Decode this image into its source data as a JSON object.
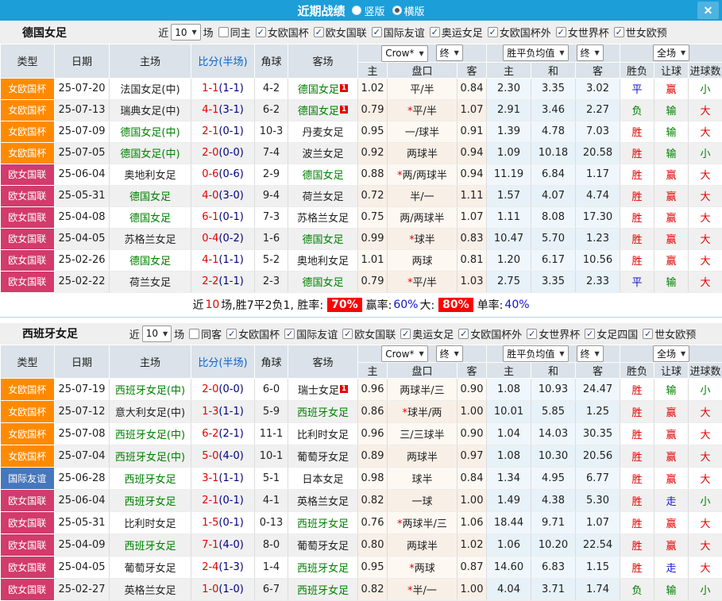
{
  "titlebar": {
    "title": "近期战绩",
    "vertical_label": "竖版",
    "horizontal_label": "横版",
    "close": "✕"
  },
  "columns": {
    "type": "类型",
    "date": "日期",
    "home": "主场",
    "score": "比分(半场)",
    "corner": "角球",
    "away": "客场",
    "odds_home": "主",
    "handicap": "盘口",
    "odds_away": "客",
    "avg_home": "主",
    "avg_draw": "和",
    "avg_away": "客",
    "result": "胜负",
    "handicap_col": "让球",
    "goals_col": "进球数"
  },
  "dropdowns": {
    "provider": "Crow*",
    "final": "终",
    "avg_label": "胜平负均值",
    "final2": "终",
    "scope": "全场"
  },
  "comp_colors": {
    "女欧国杯": "#ff8a00",
    "欧女国联": "#d23b6c",
    "国际友谊": "#4677bd"
  },
  "sections": [
    {
      "team": "德国女足",
      "filter": {
        "near_label": "近",
        "count": "10",
        "unit_label": "场",
        "same_label": "同主",
        "same_checked": false,
        "competitions": [
          "女欧国杯",
          "欧女国联",
          "国际友谊",
          "奥运女足",
          "女欧国杯外",
          "女世界杯",
          "世女欧预"
        ]
      },
      "rows": [
        {
          "comp": "女欧国杯",
          "date": "25-07-20",
          "home": "法国女足(中)",
          "home_active": false,
          "score": "1-1",
          "half": "(1-1)",
          "corner": "4-2",
          "away": "德国女足",
          "away_active": true,
          "away_badge": "1",
          "odds_home": "1.02",
          "handicap": "平/半",
          "handicap_star": false,
          "odds_away": "0.84",
          "avg_home": "2.30",
          "avg_draw": "3.35",
          "avg_away": "3.02",
          "result": "平",
          "result_c": "b",
          "ah": "赢",
          "ah_c": "r",
          "goals": "小",
          "goals_c": "g"
        },
        {
          "comp": "女欧国杯",
          "date": "25-07-13",
          "home": "瑞典女足(中)",
          "home_active": false,
          "score": "4-1",
          "half": "(3-1)",
          "corner": "6-2",
          "away": "德国女足",
          "away_active": true,
          "away_badge": "1",
          "odds_home": "0.79",
          "handicap": "平/半",
          "handicap_star": true,
          "odds_away": "1.07",
          "avg_home": "2.91",
          "avg_draw": "3.46",
          "avg_away": "2.27",
          "result": "负",
          "result_c": "g",
          "ah": "输",
          "ah_c": "g",
          "goals": "大",
          "goals_c": "r"
        },
        {
          "comp": "女欧国杯",
          "date": "25-07-09",
          "home": "德国女足(中)",
          "home_active": true,
          "score": "2-1",
          "half": "(0-1)",
          "corner": "10-3",
          "away": "丹麦女足",
          "away_active": false,
          "away_badge": "",
          "odds_home": "0.95",
          "handicap": "一/球半",
          "handicap_star": false,
          "odds_away": "0.91",
          "avg_home": "1.39",
          "avg_draw": "4.78",
          "avg_away": "7.03",
          "result": "胜",
          "result_c": "r",
          "ah": "输",
          "ah_c": "g",
          "goals": "大",
          "goals_c": "r"
        },
        {
          "comp": "女欧国杯",
          "date": "25-07-05",
          "home": "德国女足(中)",
          "home_active": true,
          "score": "2-0",
          "half": "(0-0)",
          "corner": "7-4",
          "away": "波兰女足",
          "away_active": false,
          "away_badge": "",
          "odds_home": "0.92",
          "handicap": "两球半",
          "handicap_star": false,
          "odds_away": "0.94",
          "avg_home": "1.09",
          "avg_draw": "10.18",
          "avg_away": "20.58",
          "result": "胜",
          "result_c": "r",
          "ah": "输",
          "ah_c": "g",
          "goals": "小",
          "goals_c": "g"
        },
        {
          "comp": "欧女国联",
          "date": "25-06-04",
          "home": "奥地利女足",
          "home_active": false,
          "score": "0-6",
          "half": "(0-6)",
          "corner": "2-9",
          "away": "德国女足",
          "away_active": true,
          "away_badge": "",
          "odds_home": "0.88",
          "handicap": "两/两球半",
          "handicap_star": true,
          "odds_away": "0.94",
          "avg_home": "11.19",
          "avg_draw": "6.84",
          "avg_away": "1.17",
          "result": "胜",
          "result_c": "r",
          "ah": "赢",
          "ah_c": "r",
          "goals": "大",
          "goals_c": "r"
        },
        {
          "comp": "欧女国联",
          "date": "25-05-31",
          "home": "德国女足",
          "home_active": true,
          "score": "4-0",
          "half": "(3-0)",
          "corner": "9-4",
          "away": "荷兰女足",
          "away_active": false,
          "away_badge": "",
          "odds_home": "0.72",
          "handicap": "半/一",
          "handicap_star": false,
          "odds_away": "1.11",
          "avg_home": "1.57",
          "avg_draw": "4.07",
          "avg_away": "4.74",
          "result": "胜",
          "result_c": "r",
          "ah": "赢",
          "ah_c": "r",
          "goals": "大",
          "goals_c": "r"
        },
        {
          "comp": "欧女国联",
          "date": "25-04-08",
          "home": "德国女足",
          "home_active": true,
          "score": "6-1",
          "half": "(0-1)",
          "corner": "7-3",
          "away": "苏格兰女足",
          "away_active": false,
          "away_badge": "",
          "odds_home": "0.75",
          "handicap": "两/两球半",
          "handicap_star": false,
          "odds_away": "1.07",
          "avg_home": "1.11",
          "avg_draw": "8.08",
          "avg_away": "17.30",
          "result": "胜",
          "result_c": "r",
          "ah": "赢",
          "ah_c": "r",
          "goals": "大",
          "goals_c": "r"
        },
        {
          "comp": "欧女国联",
          "date": "25-04-05",
          "home": "苏格兰女足",
          "home_active": false,
          "score": "0-4",
          "half": "(0-2)",
          "corner": "1-6",
          "away": "德国女足",
          "away_active": true,
          "away_badge": "",
          "odds_home": "0.99",
          "handicap": "球半",
          "handicap_star": true,
          "odds_away": "0.83",
          "avg_home": "10.47",
          "avg_draw": "5.70",
          "avg_away": "1.23",
          "result": "胜",
          "result_c": "r",
          "ah": "赢",
          "ah_c": "r",
          "goals": "大",
          "goals_c": "r"
        },
        {
          "comp": "欧女国联",
          "date": "25-02-26",
          "home": "德国女足",
          "home_active": true,
          "score": "4-1",
          "half": "(1-1)",
          "corner": "5-2",
          "away": "奥地利女足",
          "away_active": false,
          "away_badge": "",
          "odds_home": "1.01",
          "handicap": "两球",
          "handicap_star": false,
          "odds_away": "0.81",
          "avg_home": "1.20",
          "avg_draw": "6.17",
          "avg_away": "10.56",
          "result": "胜",
          "result_c": "r",
          "ah": "赢",
          "ah_c": "r",
          "goals": "大",
          "goals_c": "r"
        },
        {
          "comp": "欧女国联",
          "date": "25-02-22",
          "home": "荷兰女足",
          "home_active": false,
          "score": "2-2",
          "half": "(1-1)",
          "corner": "2-3",
          "away": "德国女足",
          "away_active": true,
          "away_badge": "",
          "odds_home": "0.79",
          "handicap": "平/半",
          "handicap_star": true,
          "odds_away": "1.03",
          "avg_home": "2.75",
          "avg_draw": "3.35",
          "avg_away": "2.33",
          "result": "平",
          "result_c": "b",
          "ah": "输",
          "ah_c": "g",
          "goals": "大",
          "goals_c": "r"
        }
      ],
      "summary": {
        "pre": "近",
        "count": "10",
        "text1": "场,胜7平2负1, 胜率:",
        "win_rate": "70%",
        "text2": "赢率:",
        "profit_rate": "60%",
        "text3": "大:",
        "big_rate": "80%",
        "text4": "单率:",
        "single_rate": "40%"
      }
    },
    {
      "team": "西班牙女足",
      "filter": {
        "near_label": "近",
        "count": "10",
        "unit_label": "场",
        "same_label": "同客",
        "same_checked": false,
        "competitions": [
          "女欧国杯",
          "国际友谊",
          "欧女国联",
          "奥运女足",
          "女欧国杯外",
          "女世界杯",
          "女足四国",
          "世女欧预"
        ]
      },
      "rows": [
        {
          "comp": "女欧国杯",
          "date": "25-07-19",
          "home": "西班牙女足(中)",
          "home_active": true,
          "score": "2-0",
          "half": "(0-0)",
          "corner": "6-0",
          "away": "瑞士女足",
          "away_active": false,
          "away_badge": "1",
          "odds_home": "0.96",
          "handicap": "两球半/三",
          "handicap_star": false,
          "odds_away": "0.90",
          "avg_home": "1.08",
          "avg_draw": "10.93",
          "avg_away": "24.47",
          "result": "胜",
          "result_c": "r",
          "ah": "输",
          "ah_c": "g",
          "goals": "小",
          "goals_c": "g"
        },
        {
          "comp": "女欧国杯",
          "date": "25-07-12",
          "home": "意大利女足(中)",
          "home_active": false,
          "score": "1-3",
          "half": "(1-1)",
          "corner": "5-9",
          "away": "西班牙女足",
          "away_active": true,
          "away_badge": "",
          "odds_home": "0.86",
          "handicap": "球半/两",
          "handicap_star": true,
          "odds_away": "1.00",
          "avg_home": "10.01",
          "avg_draw": "5.85",
          "avg_away": "1.25",
          "result": "胜",
          "result_c": "r",
          "ah": "赢",
          "ah_c": "r",
          "goals": "大",
          "goals_c": "r"
        },
        {
          "comp": "女欧国杯",
          "date": "25-07-08",
          "home": "西班牙女足(中)",
          "home_active": true,
          "score": "6-2",
          "half": "(2-1)",
          "corner": "11-1",
          "away": "比利时女足",
          "away_active": false,
          "away_badge": "",
          "odds_home": "0.96",
          "handicap": "三/三球半",
          "handicap_star": false,
          "odds_away": "0.90",
          "avg_home": "1.04",
          "avg_draw": "14.03",
          "avg_away": "30.35",
          "result": "胜",
          "result_c": "r",
          "ah": "赢",
          "ah_c": "r",
          "goals": "大",
          "goals_c": "r"
        },
        {
          "comp": "女欧国杯",
          "date": "25-07-04",
          "home": "西班牙女足(中)",
          "home_active": true,
          "score": "5-0",
          "half": "(4-0)",
          "corner": "10-1",
          "away": "葡萄牙女足",
          "away_active": false,
          "away_badge": "",
          "odds_home": "0.89",
          "handicap": "两球半",
          "handicap_star": false,
          "odds_away": "0.97",
          "avg_home": "1.08",
          "avg_draw": "10.30",
          "avg_away": "20.56",
          "result": "胜",
          "result_c": "r",
          "ah": "赢",
          "ah_c": "r",
          "goals": "大",
          "goals_c": "r"
        },
        {
          "comp": "国际友谊",
          "date": "25-06-28",
          "home": "西班牙女足",
          "home_active": true,
          "score": "3-1",
          "half": "(1-1)",
          "corner": "5-1",
          "away": "日本女足",
          "away_active": false,
          "away_badge": "",
          "odds_home": "0.98",
          "handicap": "球半",
          "handicap_star": false,
          "odds_away": "0.84",
          "avg_home": "1.34",
          "avg_draw": "4.95",
          "avg_away": "6.77",
          "result": "胜",
          "result_c": "r",
          "ah": "赢",
          "ah_c": "r",
          "goals": "大",
          "goals_c": "r"
        },
        {
          "comp": "欧女国联",
          "date": "25-06-04",
          "home": "西班牙女足",
          "home_active": true,
          "score": "2-1",
          "half": "(0-1)",
          "corner": "4-1",
          "away": "英格兰女足",
          "away_active": false,
          "away_badge": "",
          "odds_home": "0.82",
          "handicap": "一球",
          "handicap_star": false,
          "odds_away": "1.00",
          "avg_home": "1.49",
          "avg_draw": "4.38",
          "avg_away": "5.30",
          "result": "胜",
          "result_c": "r",
          "ah": "走",
          "ah_c": "b",
          "goals": "小",
          "goals_c": "g"
        },
        {
          "comp": "欧女国联",
          "date": "25-05-31",
          "home": "比利时女足",
          "home_active": false,
          "score": "1-5",
          "half": "(0-1)",
          "corner": "0-13",
          "away": "西班牙女足",
          "away_active": true,
          "away_badge": "",
          "odds_home": "0.76",
          "handicap": "两球半/三",
          "handicap_star": true,
          "odds_away": "1.06",
          "avg_home": "18.44",
          "avg_draw": "9.71",
          "avg_away": "1.07",
          "result": "胜",
          "result_c": "r",
          "ah": "赢",
          "ah_c": "r",
          "goals": "大",
          "goals_c": "r"
        },
        {
          "comp": "欧女国联",
          "date": "25-04-09",
          "home": "西班牙女足",
          "home_active": true,
          "score": "7-1",
          "half": "(4-0)",
          "corner": "8-0",
          "away": "葡萄牙女足",
          "away_active": false,
          "away_badge": "",
          "odds_home": "0.80",
          "handicap": "两球半",
          "handicap_star": false,
          "odds_away": "1.02",
          "avg_home": "1.06",
          "avg_draw": "10.20",
          "avg_away": "22.54",
          "result": "胜",
          "result_c": "r",
          "ah": "赢",
          "ah_c": "r",
          "goals": "大",
          "goals_c": "r"
        },
        {
          "comp": "欧女国联",
          "date": "25-04-05",
          "home": "葡萄牙女足",
          "home_active": false,
          "score": "2-4",
          "half": "(1-3)",
          "corner": "1-4",
          "away": "西班牙女足",
          "away_active": true,
          "away_badge": "",
          "odds_home": "0.95",
          "handicap": "两球",
          "handicap_star": true,
          "odds_away": "0.87",
          "avg_home": "14.60",
          "avg_draw": "6.83",
          "avg_away": "1.15",
          "result": "胜",
          "result_c": "r",
          "ah": "走",
          "ah_c": "b",
          "goals": "大",
          "goals_c": "r"
        },
        {
          "comp": "欧女国联",
          "date": "25-02-27",
          "home": "英格兰女足",
          "home_active": false,
          "score": "1-0",
          "half": "(1-0)",
          "corner": "6-7",
          "away": "西班牙女足",
          "away_active": true,
          "away_badge": "",
          "odds_home": "0.82",
          "handicap": "半/一",
          "handicap_star": true,
          "odds_away": "1.00",
          "avg_home": "4.04",
          "avg_draw": "3.71",
          "avg_away": "1.74",
          "result": "负",
          "result_c": "g",
          "ah": "输",
          "ah_c": "g",
          "goals": "小",
          "goals_c": "g"
        }
      ],
      "summary": null
    }
  ]
}
